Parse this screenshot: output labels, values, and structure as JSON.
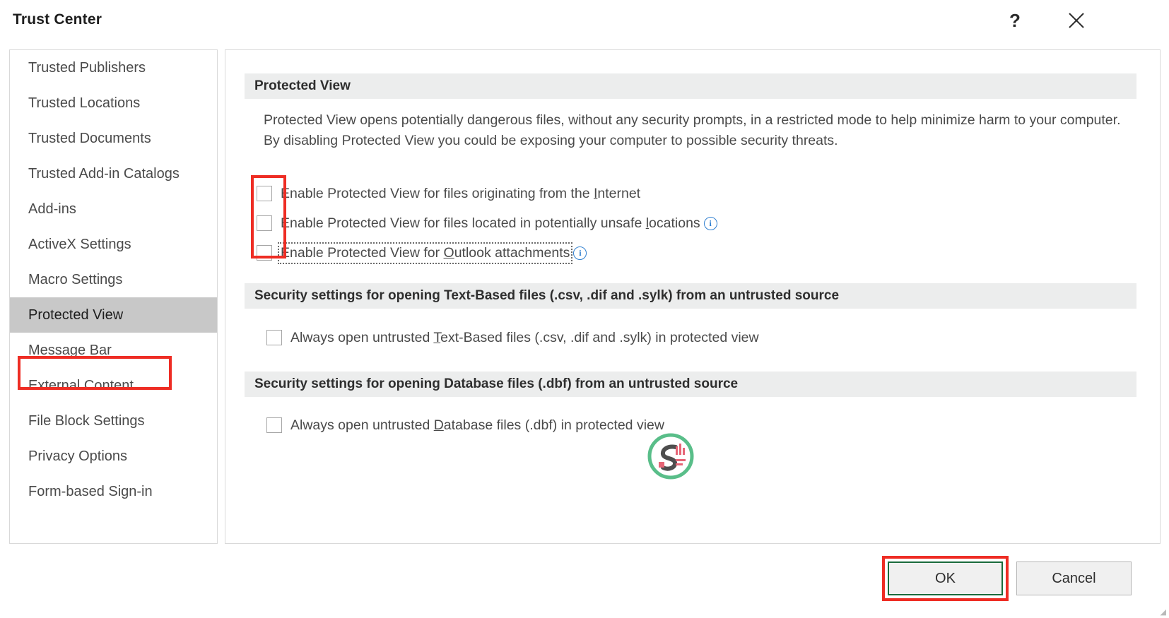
{
  "window": {
    "title": "Trust Center",
    "help_icon": "?",
    "close_icon": "close-icon"
  },
  "sidebar": {
    "items": [
      {
        "label": "Trusted Publishers",
        "selected": false
      },
      {
        "label": "Trusted Locations",
        "selected": false
      },
      {
        "label": "Trusted Documents",
        "selected": false
      },
      {
        "label": "Trusted Add-in Catalogs",
        "selected": false
      },
      {
        "label": "Add-ins",
        "selected": false
      },
      {
        "label": "ActiveX Settings",
        "selected": false
      },
      {
        "label": "Macro Settings",
        "selected": false
      },
      {
        "label": "Protected View",
        "selected": true
      },
      {
        "label": "Message Bar",
        "selected": false
      },
      {
        "label": "External Content",
        "selected": false
      },
      {
        "label": "File Block Settings",
        "selected": false
      },
      {
        "label": "Privacy Options",
        "selected": false
      },
      {
        "label": "Form-based Sign-in",
        "selected": false
      }
    ]
  },
  "main": {
    "protected_view": {
      "header": "Protected View",
      "description": "Protected View opens potentially dangerous files, without any security prompts, in a restricted mode to help minimize harm to your computer. By disabling Protected View you could be exposing your computer to possible security threats.",
      "checkboxes": [
        {
          "label_before": "Enable Protected View for files originating from the ",
          "accel": "I",
          "label_after": "nternet",
          "checked": false,
          "has_info": false,
          "focused": false
        },
        {
          "label_before": "Enable Protected View for files located in potentially unsafe ",
          "accel": "l",
          "label_after": "ocations",
          "checked": false,
          "has_info": true,
          "focused": false
        },
        {
          "label_before": "Enable Protected View for ",
          "accel": "O",
          "label_after": "utlook attachments",
          "checked": false,
          "has_info": true,
          "focused": true
        }
      ]
    },
    "text_based": {
      "header": "Security settings for opening Text-Based files (.csv, .dif and .sylk) from an untrusted source",
      "checkbox": {
        "label_before": "Always open untrusted ",
        "accel": "T",
        "label_after": "ext-Based files (.csv, .dif and .sylk) in protected view",
        "checked": false
      }
    },
    "database": {
      "header": "Security settings for opening Database files (.dbf) from an untrusted source",
      "checkbox": {
        "label_before": "Always open untrusted ",
        "accel": "D",
        "label_after": "atabase files (.dbf) in protected view",
        "checked": false
      }
    }
  },
  "footer": {
    "ok_label": "OK",
    "cancel_label": "Cancel"
  },
  "annotations": {
    "color": "#ee2d24",
    "default_button_color": "#1a6b3c"
  },
  "watermark": {
    "letter": "S",
    "ring_color": "#4cb97f",
    "accent_color": "#e4596b"
  }
}
